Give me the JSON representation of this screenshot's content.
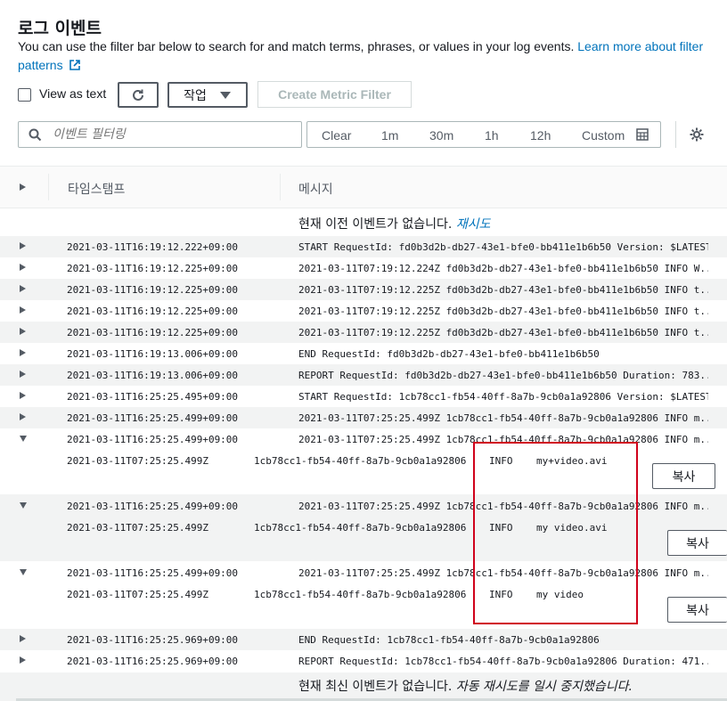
{
  "header": {
    "title": "로그 이벤트",
    "description": "You can use the filter bar below to search for and match terms, phrases, or values in your log events.",
    "learn_more_link": "Learn more about filter patterns"
  },
  "toolbar": {
    "view_as_text_label": "View as text",
    "actions_label": "작업",
    "create_metric_filter_label": "Create Metric Filter",
    "search_placeholder": "이벤트 필터링",
    "clear_label": "Clear",
    "time_ranges": [
      "1m",
      "30m",
      "1h",
      "12h"
    ],
    "custom_label": "Custom"
  },
  "columns": {
    "timestamp": "타임스탬프",
    "message": "메시지"
  },
  "notices": {
    "no_older_prefix": "현재 이전 이벤트가 없습니다.",
    "retry_link": "재시도",
    "no_newer_prefix": "현재 최신 이벤트가 없습니다.",
    "auto_retry_text": "자동 재시도를 일시 중지했습니다."
  },
  "rows": [
    {
      "ts": "2021-03-11T16:19:12.222+09:00",
      "msg": "START RequestId: fd0b3d2b-db27-43e1-bfe0-bb411e1b6b50 Version: $LATEST"
    },
    {
      "ts": "2021-03-11T16:19:12.225+09:00",
      "msg": "2021-03-11T07:19:12.224Z fd0b3d2b-db27-43e1-bfe0-bb411e1b6b50 INFO W..."
    },
    {
      "ts": "2021-03-11T16:19:12.225+09:00",
      "msg": "2021-03-11T07:19:12.225Z fd0b3d2b-db27-43e1-bfe0-bb411e1b6b50 INFO t..."
    },
    {
      "ts": "2021-03-11T16:19:12.225+09:00",
      "msg": "2021-03-11T07:19:12.225Z fd0b3d2b-db27-43e1-bfe0-bb411e1b6b50 INFO t..."
    },
    {
      "ts": "2021-03-11T16:19:12.225+09:00",
      "msg": "2021-03-11T07:19:12.225Z fd0b3d2b-db27-43e1-bfe0-bb411e1b6b50 INFO t..."
    },
    {
      "ts": "2021-03-11T16:19:13.006+09:00",
      "msg": "END RequestId: fd0b3d2b-db27-43e1-bfe0-bb411e1b6b50"
    },
    {
      "ts": "2021-03-11T16:19:13.006+09:00",
      "msg": "REPORT RequestId: fd0b3d2b-db27-43e1-bfe0-bb411e1b6b50 Duration: 783..."
    },
    {
      "ts": "2021-03-11T16:25:25.495+09:00",
      "msg": "START RequestId: 1cb78cc1-fb54-40ff-8a7b-9cb0a1a92806 Version: $LATEST"
    },
    {
      "ts": "2021-03-11T16:25:25.499+09:00",
      "msg": "2021-03-11T07:25:25.499Z 1cb78cc1-fb54-40ff-8a7b-9cb0a1a92806 INFO m..."
    }
  ],
  "expanded": [
    {
      "ts": "2021-03-11T16:25:25.499+09:00",
      "msg": "2021-03-11T07:25:25.499Z 1cb78cc1-fb54-40ff-8a7b-9cb0a1a92806 INFO m...",
      "d_ts": "2021-03-11T07:25:25.499Z",
      "d_id": "1cb78cc1-fb54-40ff-8a7b-9cb0a1a92806",
      "d_level": "INFO",
      "d_msg": "my+video.avi",
      "copy": "복사"
    },
    {
      "ts": "2021-03-11T16:25:25.499+09:00",
      "msg": "2021-03-11T07:25:25.499Z 1cb78cc1-fb54-40ff-8a7b-9cb0a1a92806 INFO m...",
      "d_ts": "2021-03-11T07:25:25.499Z",
      "d_id": "1cb78cc1-fb54-40ff-8a7b-9cb0a1a92806",
      "d_level": "INFO",
      "d_msg": "my video.avi",
      "copy": "복사"
    },
    {
      "ts": "2021-03-11T16:25:25.499+09:00",
      "msg": "2021-03-11T07:25:25.499Z 1cb78cc1-fb54-40ff-8a7b-9cb0a1a92806 INFO m...",
      "d_ts": "2021-03-11T07:25:25.499Z",
      "d_id": "1cb78cc1-fb54-40ff-8a7b-9cb0a1a92806",
      "d_level": "INFO",
      "d_msg": "my video",
      "copy": "복사"
    }
  ],
  "tail_rows": [
    {
      "ts": "2021-03-11T16:25:25.969+09:00",
      "msg": "END RequestId: 1cb78cc1-fb54-40ff-8a7b-9cb0a1a92806"
    },
    {
      "ts": "2021-03-11T16:25:25.969+09:00",
      "msg": "REPORT RequestId: 1cb78cc1-fb54-40ff-8a7b-9cb0a1a92806 Duration: 471..."
    }
  ],
  "colors": {
    "link": "#0073bb",
    "highlight_box": "#d0021b",
    "stripe": "#f2f3f3"
  },
  "icons": [
    "external-link-icon",
    "refresh-icon",
    "caret-down-icon",
    "search-icon",
    "calendar-icon",
    "gear-icon",
    "expand-arrow-icon",
    "collapse-arrow-icon"
  ]
}
